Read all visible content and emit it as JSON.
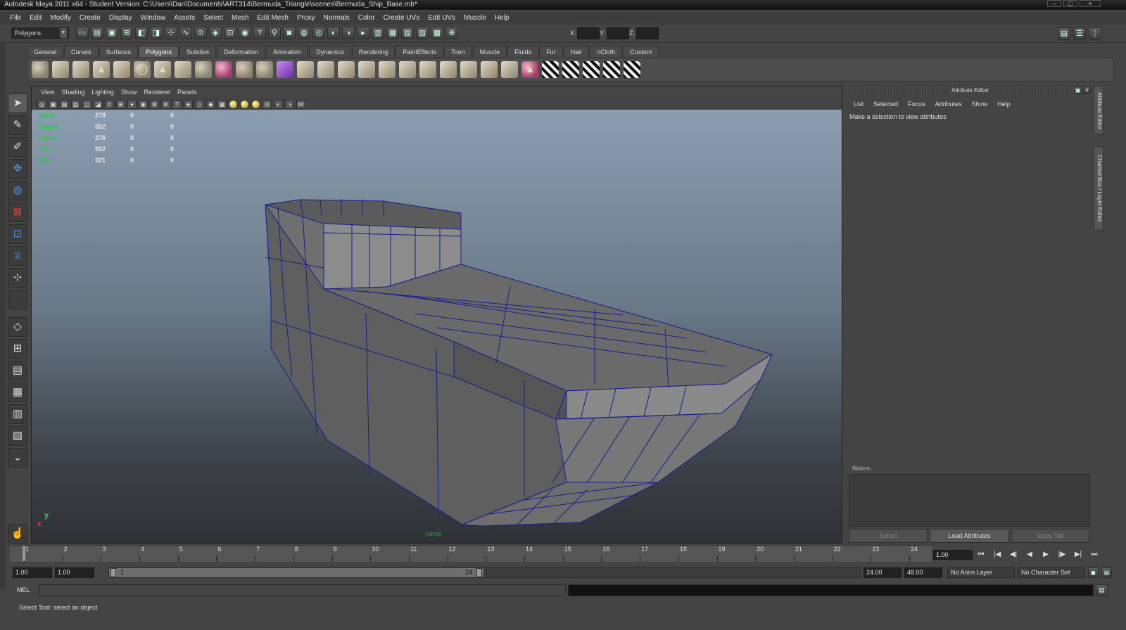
{
  "window": {
    "title": "Autodesk Maya 2011 x64 - Student Version: C:\\Users\\Dan\\Documents\\ART314\\Bermuda_Triangle\\scenes\\Bermuda_Ship_Base.mb*",
    "controls": [
      "–",
      "□",
      "×"
    ]
  },
  "menubar": [
    "File",
    "Edit",
    "Modify",
    "Create",
    "Display",
    "Window",
    "Assets",
    "Select",
    "Mesh",
    "Edit Mesh",
    "Proxy",
    "Normals",
    "Color",
    "Create UVs",
    "Edit UVs",
    "Muscle",
    "Help"
  ],
  "statusline": {
    "menuset": "Polygons",
    "x_label": "X:",
    "y_label": "Y:",
    "z_label": "Z:",
    "x_value": "",
    "y_value": "",
    "z_value": ""
  },
  "shelf": {
    "tabs": [
      "General",
      "Curves",
      "Surfaces",
      "Polygons",
      "Subdivs",
      "Deformation",
      "Animation",
      "Dynamics",
      "Rendering",
      "PaintEffects",
      "Toon",
      "Muscle",
      "Fluids",
      "Fur",
      "Hair",
      "nCloth",
      "Custom"
    ],
    "active_tab": "Polygons"
  },
  "viewport": {
    "menu": [
      "View",
      "Shading",
      "Lighting",
      "Show",
      "Renderer",
      "Panels"
    ],
    "camera": "persp",
    "hud": [
      {
        "label": "Verts:",
        "v1": "278",
        "v2": "0",
        "v3": "0"
      },
      {
        "label": "Edges:",
        "v1": "552",
        "v2": "0",
        "v3": "0"
      },
      {
        "label": "Faces:",
        "v1": "276",
        "v2": "0",
        "v3": "0"
      },
      {
        "label": "Tris:",
        "v1": "552",
        "v2": "0",
        "v3": "0"
      },
      {
        "label": "UVs:",
        "v1": "321",
        "v2": "0",
        "v3": "0"
      }
    ],
    "axis_y": "y",
    "axis_x": "x"
  },
  "attribute_editor": {
    "title": "Attribute Editor",
    "menu": [
      "List",
      "Selected",
      "Focus",
      "Attributes",
      "Show",
      "Help"
    ],
    "message": "Make a selection to view attributes",
    "notes_label": "Notes:",
    "buttons": [
      "Select",
      "Load Attributes",
      "Copy Tab"
    ]
  },
  "side_tabs": [
    "Attribute Editor",
    "Channel Box / Layer Editor"
  ],
  "timeline": {
    "frames": [
      "1",
      "2",
      "3",
      "4",
      "5",
      "6",
      "7",
      "8",
      "9",
      "10",
      "11",
      "12",
      "13",
      "14",
      "15",
      "16",
      "17",
      "18",
      "19",
      "20",
      "21",
      "22",
      "23",
      "24"
    ],
    "current_time": "1.00"
  },
  "range": {
    "start_time": "1.00",
    "playback_start": "1.00",
    "slider_start": "1",
    "slider_end": "24",
    "playback_end": "24.00",
    "end_time": "48.00",
    "anim_layer": "No Anim Layer",
    "character_set": "No Character Set"
  },
  "command_line": {
    "label": "MEL"
  },
  "help_line": "Select Tool: select an object"
}
